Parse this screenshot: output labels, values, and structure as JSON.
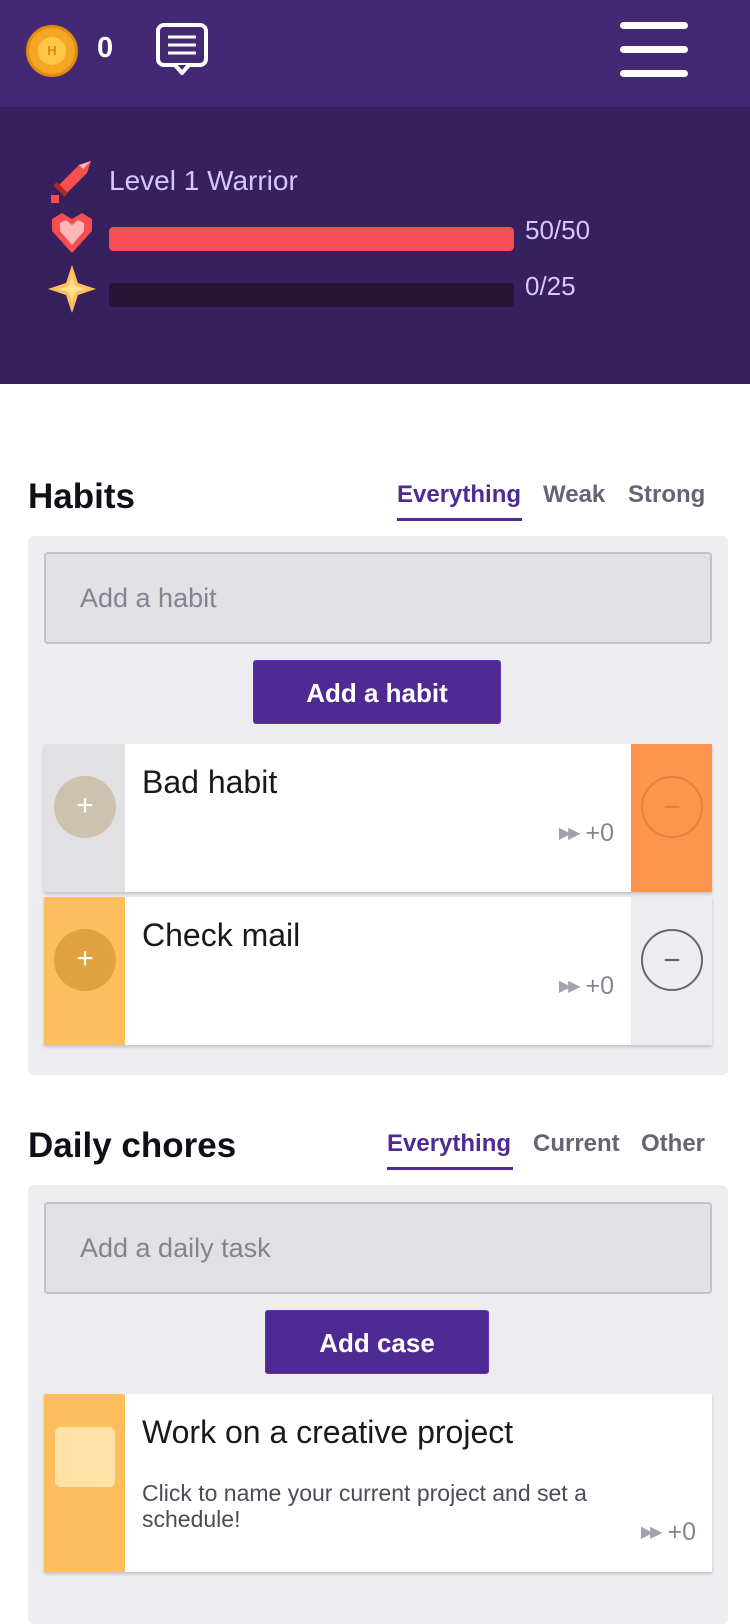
{
  "header": {
    "gold_count": "0",
    "gold_icon": "gold-coin-icon",
    "chat_icon": "chat-bubble-icon",
    "menu_icon": "hamburger-menu-icon"
  },
  "stats": {
    "level_label": "Level 1 Warrior",
    "health": {
      "value": "50/50",
      "fraction": 1.0,
      "color": "#f74e52"
    },
    "experience": {
      "value": "0/25",
      "fraction": 0.0,
      "color": "#ffbe5d"
    }
  },
  "habits": {
    "title": "Habits",
    "filters": [
      "Everything",
      "Weak",
      "Strong"
    ],
    "active_filter": "Everything",
    "input_placeholder": "Add a habit",
    "add_button": "Add a habit",
    "items": [
      {
        "title": "Bad habit",
        "plus": "+",
        "minus": "−",
        "streak": "+0",
        "left_color": "#e1e0e3",
        "right_color": "#ff944c"
      },
      {
        "title": "Check mail",
        "plus": "+",
        "minus": "−",
        "streak": "+0",
        "left_color": "#ffbe5d",
        "right_color": "#ededf0"
      }
    ]
  },
  "dailies": {
    "title": "Daily chores",
    "filters": [
      "Everything",
      "Current",
      "Other"
    ],
    "active_filter": "Everything",
    "input_placeholder": "Add a daily task",
    "add_button": "Add case",
    "items": [
      {
        "title": "Work on a creative project",
        "note": "Click to name your current project and set a schedule!",
        "streak": "+0",
        "left_color": "#ffbe5d"
      }
    ]
  }
}
